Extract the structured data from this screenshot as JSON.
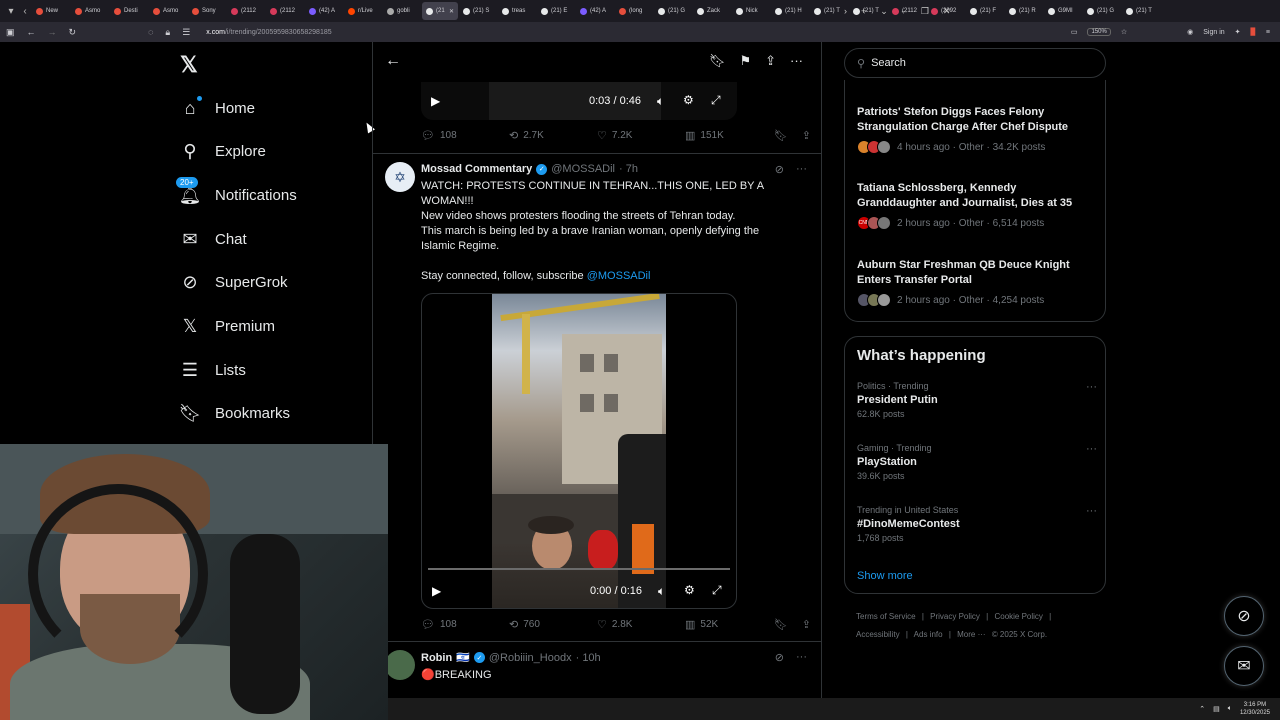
{
  "browser": {
    "tabs": [
      {
        "label": "New",
        "color": "#e64e3c"
      },
      {
        "label": "Asmo",
        "color": "#e64e3c"
      },
      {
        "label": "Desti",
        "color": "#e64e3c"
      },
      {
        "label": "Asmo",
        "color": "#e64e3c"
      },
      {
        "label": "Sony",
        "color": "#e64e3c"
      },
      {
        "label": "(2112",
        "color": "#d63a5a"
      },
      {
        "label": "(2112",
        "color": "#d63a5a"
      },
      {
        "label": "(42) A",
        "color": "#7b5cff"
      },
      {
        "label": "r/Live",
        "color": "#ff4500"
      },
      {
        "label": "gobli",
        "color": "#aaaaaa"
      },
      {
        "label": "(21",
        "color": "#e7e9ea"
      },
      {
        "label": "(21) S",
        "color": "#e7e9ea"
      },
      {
        "label": "treas",
        "color": "#e7e9ea"
      },
      {
        "label": "(21) E",
        "color": "#e7e9ea"
      },
      {
        "label": "(42) A",
        "color": "#7b5cff"
      },
      {
        "label": "(long",
        "color": "#e64e3c"
      },
      {
        "label": "(21) G",
        "color": "#e7e9ea"
      },
      {
        "label": "Zack",
        "color": "#e7e9ea"
      },
      {
        "label": "Nick",
        "color": "#e7e9ea"
      },
      {
        "label": "(21) H",
        "color": "#e7e9ea"
      },
      {
        "label": "(21) T",
        "color": "#e7e9ea"
      },
      {
        "label": "(21) T",
        "color": "#e7e9ea"
      },
      {
        "label": "(2112",
        "color": "#d63a5a"
      },
      {
        "label": "(2092",
        "color": "#d63a5a"
      },
      {
        "label": "(21) F",
        "color": "#e7e9ea"
      },
      {
        "label": "(21) R",
        "color": "#e7e9ea"
      },
      {
        "label": "G9MI",
        "color": "#e7e9ea"
      },
      {
        "label": "(21) G",
        "color": "#e7e9ea"
      },
      {
        "label": "(21) T",
        "color": "#e7e9ea"
      }
    ],
    "active_tab_index": 10,
    "url_host": "x.com",
    "url_path": "/i/trending/2005959830658298185",
    "zoom": "150%",
    "sign_in": "Sign in"
  },
  "nav": {
    "items": [
      {
        "label": "Home",
        "icon": "home-icon"
      },
      {
        "label": "Explore",
        "icon": "search-icon"
      },
      {
        "label": "Notifications",
        "icon": "bell-icon",
        "badge": "20+"
      },
      {
        "label": "Chat",
        "icon": "mail-icon"
      },
      {
        "label": "SuperGrok",
        "icon": "grok-icon"
      },
      {
        "label": "Premium",
        "icon": "x-logo-icon"
      },
      {
        "label": "Lists",
        "icon": "list-icon"
      },
      {
        "label": "Bookmarks",
        "icon": "bookmark-icon"
      }
    ]
  },
  "post1": {
    "time": "0:03 / 0:46",
    "replies": "108",
    "reposts": "2.7K",
    "likes": "7.2K",
    "views": "151K"
  },
  "post2": {
    "name": "Mossad Commentary",
    "handle": "@MOSSADil",
    "age": "· 7h",
    "lines": [
      "WATCH: PROTESTS CONTINUE IN TEHRAN...THIS ONE, LED BY A",
      "WOMAN!!!",
      "New video shows protesters flooding the streets of Tehran today.",
      "This march is being led by a brave Iranian woman, openly defying the",
      "Islamic Regime.",
      ""
    ],
    "cta": "Stay connected, follow, subscribe ",
    "cta_link": "@MOSSADil",
    "video_time": "0:00 / 0:16",
    "progress": 0.0,
    "replies": "108",
    "reposts": "760",
    "likes": "2.8K",
    "views": "52K"
  },
  "post3": {
    "name": "Robin",
    "flag": "🇮🇱",
    "handle": "@Robiiin_Hoodx",
    "age": "· 10h",
    "text": "🔴BREAKING"
  },
  "right": {
    "search_placeholder": "Search",
    "news": [
      {
        "title": "Patriots' Stefon Diggs Faces Felony Strangulation Charge After Chef Dispute",
        "meta": "4 hours ago · Other · 34.2K posts"
      },
      {
        "title": "Tatiana Schlossberg, Kennedy Granddaughter and Journalist, Dies at 35",
        "meta": "2 hours ago · Other · 6,514 posts",
        "face_text": "CNN"
      },
      {
        "title": "Auburn Star Freshman QB Deuce Knight Enters Transfer Portal",
        "meta": "2 hours ago · Other · 4,254 posts"
      }
    ],
    "whats_happening": "What’s happening",
    "trends": [
      {
        "context": "Politics · Trending",
        "name": "President Putin",
        "count": "62.8K posts"
      },
      {
        "context": "Gaming · Trending",
        "name": "PlayStation",
        "count": "39.6K posts"
      },
      {
        "context": "Trending in United States",
        "name": "#DinoMemeContest",
        "count": "1,768 posts"
      }
    ],
    "show_more": "Show more",
    "footer": [
      "Terms of Service",
      "|",
      "Privacy Policy",
      "|",
      "Cookie Policy",
      "|",
      "Accessibility",
      "|",
      "Ads info",
      "|",
      "More ···",
      "© 2025 X Corp."
    ]
  },
  "taskbar": {
    "time": "3:16 PM",
    "date": "12/30/2025"
  }
}
